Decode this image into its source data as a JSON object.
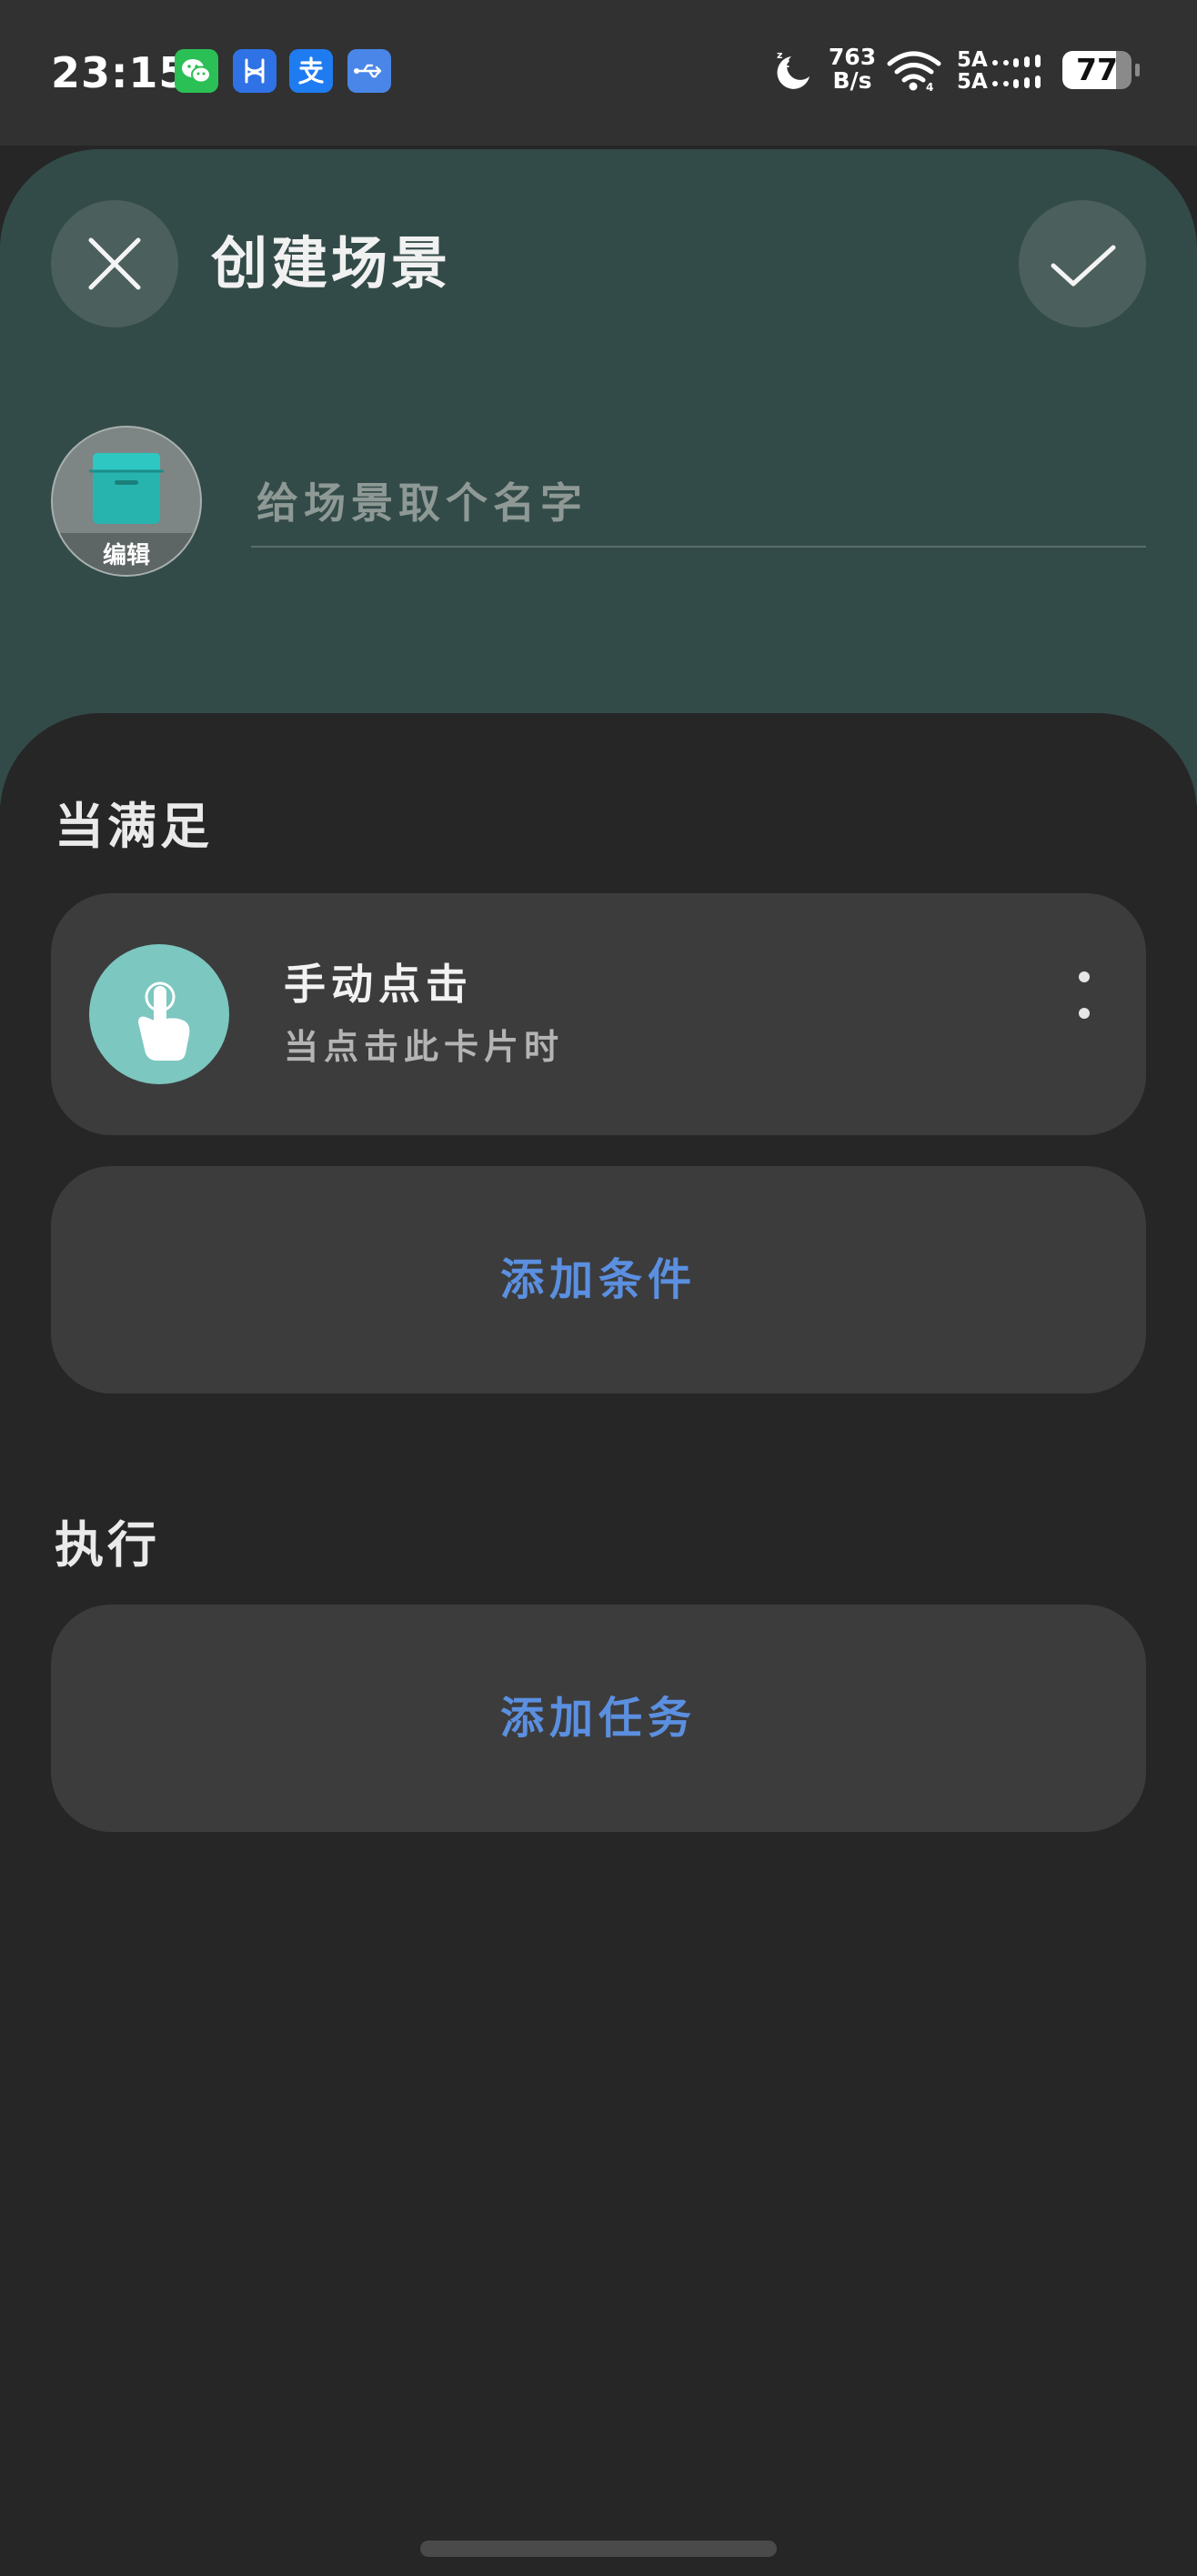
{
  "status_bar": {
    "time": "23:15",
    "apps": [
      "wechat-icon",
      "xiaohongshu-icon",
      "alipay-icon",
      "usb-icon"
    ],
    "net_speed_value": "763",
    "net_speed_unit": "B/s",
    "sim1": "5A",
    "sim2": "5A",
    "battery": "77",
    "battery_level": 0.77
  },
  "header": {
    "title": "创建场景",
    "close_icon": "close-icon",
    "confirm_icon": "check-icon",
    "scene_icon": "archive-box-icon",
    "scene_icon_edit_label": "编辑",
    "name_placeholder": "给场景取个名字",
    "name_value": ""
  },
  "conditions": {
    "title": "当满足",
    "items": [
      {
        "icon": "tap-hand-icon",
        "title": "手动点击",
        "subtitle": "当点击此卡片时"
      }
    ],
    "add_label": "添加条件"
  },
  "actions": {
    "title": "执行",
    "add_label": "添加任务"
  },
  "colors": {
    "header_bg": "#334b48",
    "page_bg": "#262626",
    "card_bg": "#3c3c3c",
    "accent": "#5b8fe0",
    "trigger_icon_bg": "#7cc7c0"
  }
}
